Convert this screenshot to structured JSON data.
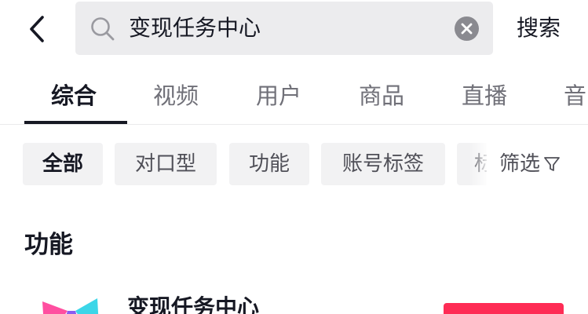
{
  "header": {
    "search_query": "变现任务中心",
    "search_button": "搜索"
  },
  "tabs": [
    {
      "label": "综合",
      "active": true
    },
    {
      "label": "视频",
      "active": false
    },
    {
      "label": "用户",
      "active": false
    },
    {
      "label": "商品",
      "active": false
    },
    {
      "label": "直播",
      "active": false
    },
    {
      "label": "音",
      "active": false
    }
  ],
  "chips": [
    {
      "label": "全部",
      "active": true
    },
    {
      "label": "对口型",
      "active": false
    },
    {
      "label": "功能",
      "active": false
    },
    {
      "label": "账号标签",
      "active": false
    },
    {
      "label": "标",
      "active": false
    }
  ],
  "filter": {
    "label": "筛选"
  },
  "section": {
    "title": "功能"
  },
  "result": {
    "title": "变现任务中心"
  },
  "colors": {
    "accent": "#fe2c55",
    "text_primary": "#161823",
    "text_secondary": "#707078",
    "search_bg": "#ececee",
    "chip_bg": "#f2f2f3"
  },
  "icons": {
    "back": "chevron-left-icon",
    "search": "search-icon",
    "clear": "clear-icon",
    "filter": "funnel-icon",
    "logo": "app-logo-icon"
  }
}
